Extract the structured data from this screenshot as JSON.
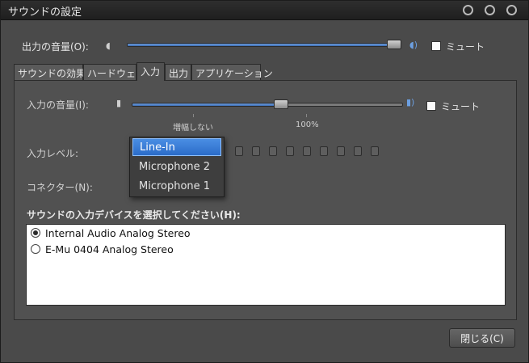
{
  "window": {
    "title": "サウンドの設定"
  },
  "output_volume": {
    "label": "出力の音量(O):",
    "level_percent": 100,
    "mute_label": "ミュート",
    "muted": false
  },
  "tabs": [
    {
      "label": "サウンドの効果",
      "active": false
    },
    {
      "label": "ハードウェア",
      "active": false
    },
    {
      "label": "入力",
      "active": true
    },
    {
      "label": "出力",
      "active": false
    },
    {
      "label": "アプリケーション",
      "active": false
    }
  ],
  "input": {
    "volume_label": "入力の音量(I):",
    "level_percent": 55,
    "mute_label": "ミュート",
    "muted": false,
    "scale_unamplified": "増幅しない",
    "scale_100": "100%",
    "level_label": "入力レベル:",
    "connector_label": "コネクター(N):",
    "devices_heading": "サウンドの入力デバイスを選択してください(H):",
    "devices": [
      {
        "name": "Internal Audio Analog Stereo",
        "selected": true
      },
      {
        "name": "E-Mu 0404 Analog Stereo",
        "selected": false
      }
    ]
  },
  "connector_dropdown": {
    "options": [
      "Line-In",
      "Microphone 2",
      "Microphone 1"
    ],
    "highlighted": "Line-In"
  },
  "close_button": {
    "label": "閉じる(C)"
  }
}
